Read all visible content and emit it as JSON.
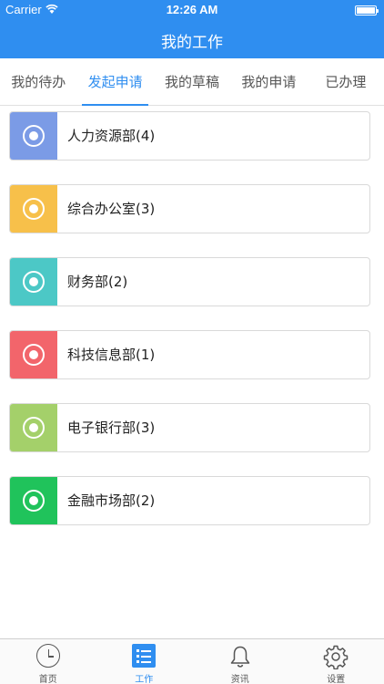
{
  "status": {
    "carrier": "Carrier",
    "time": "12:26 AM"
  },
  "header": {
    "title": "我的工作"
  },
  "tabs": [
    {
      "label": "我的待办"
    },
    {
      "label": "发起申请"
    },
    {
      "label": "我的草稿"
    },
    {
      "label": "我的申请"
    },
    {
      "label": "已办理"
    }
  ],
  "departments": [
    {
      "label": "人力资源部(4)",
      "color": "#7b9be6"
    },
    {
      "label": "综合办公室(3)",
      "color": "#f7c04a"
    },
    {
      "label": "财务部(2)",
      "color": "#4cc8c6"
    },
    {
      "label": "科技信息部(1)",
      "color": "#f2656b"
    },
    {
      "label": "电子银行部(3)",
      "color": "#a4d06a"
    },
    {
      "label": "金融市场部(2)",
      "color": "#20c35b"
    }
  ],
  "tabbar": [
    {
      "label": "首页",
      "icon": "clock-icon"
    },
    {
      "label": "工作",
      "icon": "list-icon"
    },
    {
      "label": "资讯",
      "icon": "bell-icon"
    },
    {
      "label": "设置",
      "icon": "gear-icon"
    }
  ],
  "colors": {
    "accent": "#2f8ef0"
  }
}
